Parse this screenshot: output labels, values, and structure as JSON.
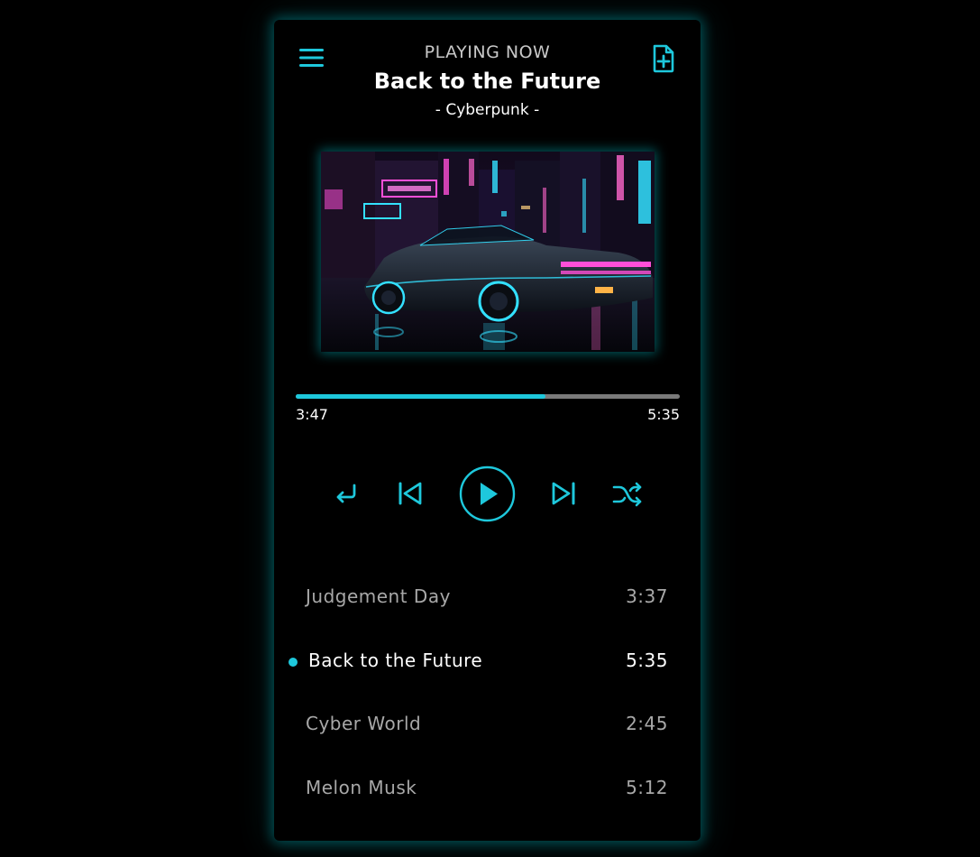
{
  "header": {
    "status": "PLAYING NOW",
    "title": "Back to the Future",
    "album": "- Cyberpunk -"
  },
  "icons": {
    "menu": "hamburger-menu-icon",
    "add": "file-plus-icon",
    "repeat": "repeat-icon",
    "previous": "skip-previous-icon",
    "play": "play-icon",
    "next": "skip-next-icon",
    "shuffle": "shuffle-icon"
  },
  "progress": {
    "current": "3:47",
    "total": "5:35",
    "fraction": 0.65
  },
  "playlist": [
    {
      "title": "Judgement Day",
      "duration": "3:37",
      "active": false
    },
    {
      "title": "Back to the Future",
      "duration": "5:35",
      "active": true
    },
    {
      "title": "Cyber World",
      "duration": "2:45",
      "active": false
    },
    {
      "title": "Melon Musk",
      "duration": "5:12",
      "active": false
    }
  ],
  "colors": {
    "accent": "#1ec8dc",
    "background": "#000000",
    "text": "#ffffff",
    "muted": "#a8a8a8"
  }
}
